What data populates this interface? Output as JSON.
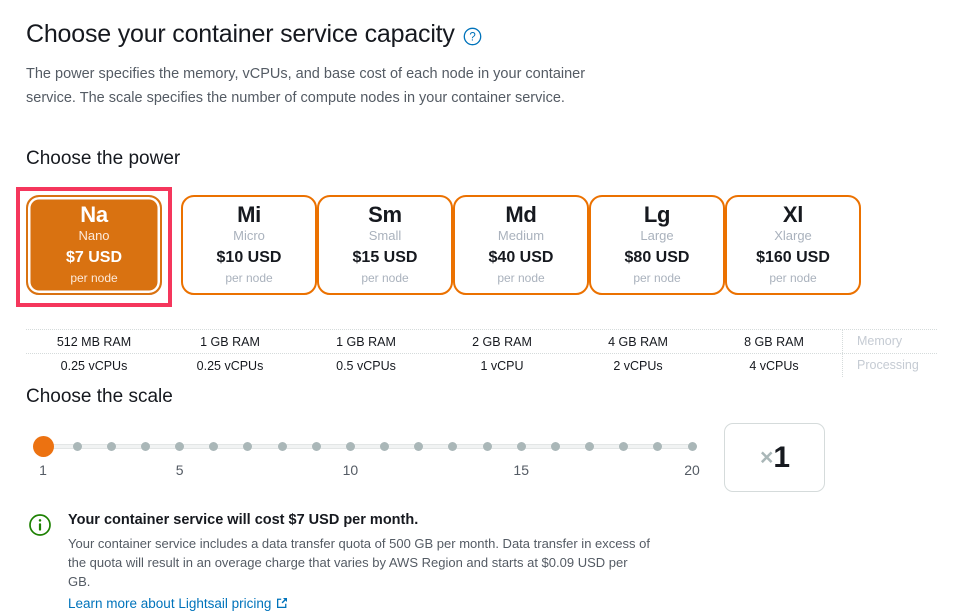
{
  "header": {
    "title": "Choose your container service capacity",
    "help_icon": "help-circle-icon",
    "intro": "The power specifies the memory, vCPUs, and base cost of each node in your container service. The scale specifies the number of compute nodes in your container service."
  },
  "power_section": {
    "heading": "Choose the power",
    "selected_index": 0,
    "accent_color": "#eb7100",
    "selected_fill": "#d97211",
    "focus_color": "#f5365c",
    "cards": [
      {
        "abbr": "Na",
        "name": "Nano",
        "price": "$7 USD",
        "unit": "per node",
        "selected": true
      },
      {
        "abbr": "Mi",
        "name": "Micro",
        "price": "$10 USD",
        "unit": "per node",
        "selected": false
      },
      {
        "abbr": "Sm",
        "name": "Small",
        "price": "$15 USD",
        "unit": "per node",
        "selected": false
      },
      {
        "abbr": "Md",
        "name": "Medium",
        "price": "$40 USD",
        "unit": "per node",
        "selected": false
      },
      {
        "abbr": "Lg",
        "name": "Large",
        "price": "$80 USD",
        "unit": "per node",
        "selected": false
      },
      {
        "abbr": "Xl",
        "name": "Xlarge",
        "price": "$160 USD",
        "unit": "per node",
        "selected": false
      }
    ]
  },
  "specs": {
    "rows": [
      {
        "label": "Memory",
        "values": [
          "512 MB RAM",
          "1 GB RAM",
          "1 GB RAM",
          "2 GB RAM",
          "4 GB RAM",
          "8 GB RAM"
        ]
      },
      {
        "label": "Processing",
        "values": [
          "0.25 vCPUs",
          "0.25 vCPUs",
          "0.5 vCPUs",
          "1 vCPU",
          "2 vCPUs",
          "4 vCPUs"
        ]
      }
    ]
  },
  "scale_section": {
    "heading": "Choose the scale",
    "min": 1,
    "max": 20,
    "value": 1,
    "tick_labels": [
      "1",
      "5",
      "10",
      "15",
      "20"
    ],
    "tick_label_values": [
      1,
      5,
      10,
      15,
      20
    ],
    "thumb_color": "#ec7211",
    "dot_color": "#aab7b8",
    "multiplier": {
      "symbol": "×",
      "value": "1"
    }
  },
  "info": {
    "icon": "info-circle-icon",
    "icon_color": "#1d8102",
    "title": "Your container service will cost $7 USD per month.",
    "text": "Your container service includes a data transfer quota of 500 GB per month. Data transfer in excess of the quota will result in an overage charge that varies by AWS Region and starts at $0.09 USD per GB.",
    "link_label": "Learn more about Lightsail pricing",
    "link_icon": "external-link-icon",
    "link_color": "#0073bb"
  }
}
